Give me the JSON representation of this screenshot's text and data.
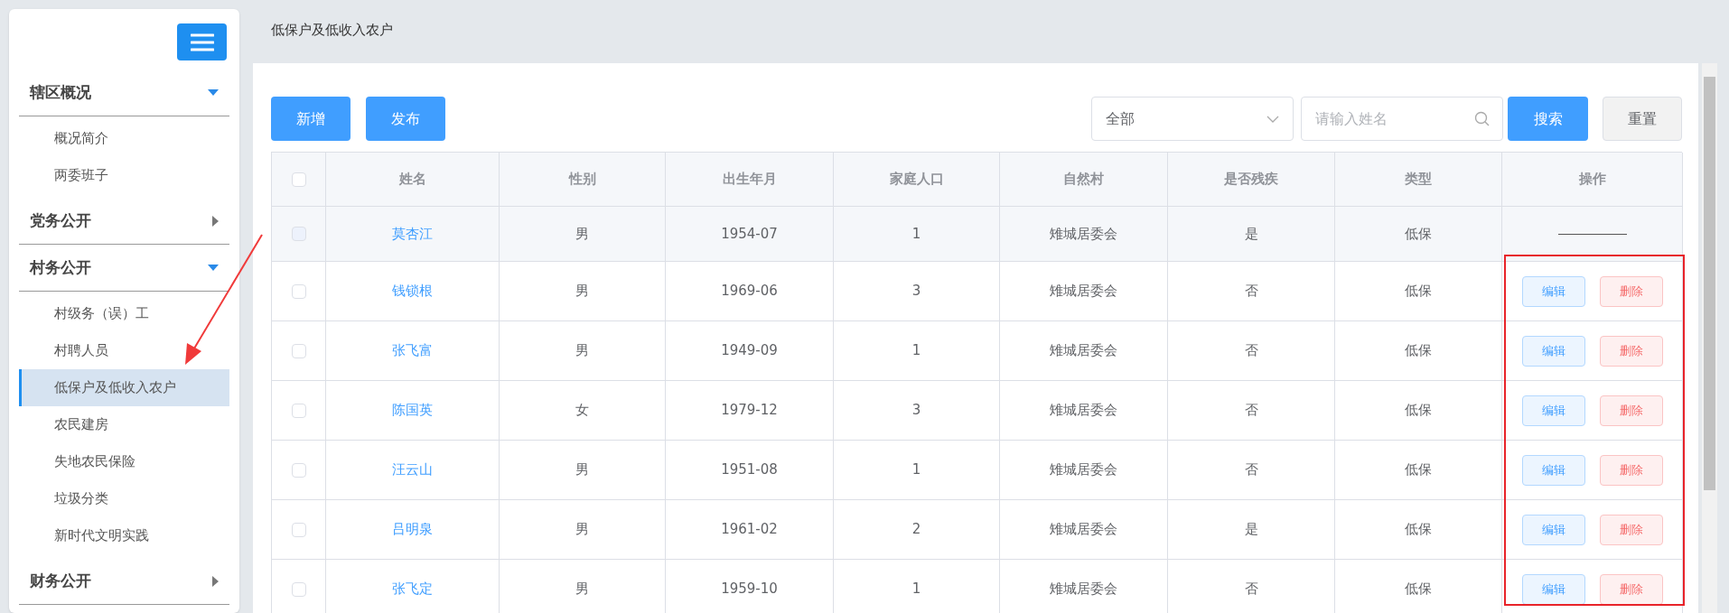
{
  "sidebar": {
    "sections": [
      {
        "title": "辖区概况",
        "expanded": true,
        "items": [
          {
            "label": "概况简介",
            "selected": false
          },
          {
            "label": "两委班子",
            "selected": false
          }
        ]
      },
      {
        "title": "党务公开",
        "expanded": false
      },
      {
        "title": "村务公开",
        "expanded": true,
        "items": [
          {
            "label": "村级务（误）工",
            "selected": false
          },
          {
            "label": "村聘人员",
            "selected": false
          },
          {
            "label": "低保户及低收入农户",
            "selected": true
          },
          {
            "label": "农民建房",
            "selected": false
          },
          {
            "label": "失地农民保险",
            "selected": false
          },
          {
            "label": "垃圾分类",
            "selected": false
          },
          {
            "label": "新时代文明实践",
            "selected": false
          }
        ]
      },
      {
        "title": "财务公开",
        "expanded": false
      }
    ]
  },
  "page_title": "低保户及低收入农户",
  "toolbar": {
    "buttons": [
      "新增",
      "发布"
    ],
    "filter": {
      "value": "全部"
    },
    "search": {
      "placeholder": "请输入姓名"
    },
    "search_button": "搜索",
    "reset_button": "重置"
  },
  "table": {
    "select_all": {
      "checked": false
    },
    "columns": [
      "姓名",
      "性别",
      "出生年月",
      "家庭人口",
      "自然村",
      "是否残疾",
      "类型",
      "操作"
    ],
    "rows": [
      {
        "cells": [
          "莫杏江",
          "男",
          "1954-07",
          "1",
          "雉城居委会",
          "是",
          "低保"
        ],
        "disabled": true,
        "actions": []
      },
      {
        "cells": [
          "钱锁根",
          "男",
          "1969-06",
          "3",
          "雉城居委会",
          "否",
          "低保"
        ],
        "disabled": false,
        "actions": [
          "编辑",
          "删除"
        ]
      },
      {
        "cells": [
          "张飞富",
          "男",
          "1949-09",
          "1",
          "雉城居委会",
          "否",
          "低保"
        ],
        "disabled": false,
        "actions": [
          "编辑",
          "删除"
        ]
      },
      {
        "cells": [
          "陈国英",
          "女",
          "1979-12",
          "3",
          "雉城居委会",
          "否",
          "低保"
        ],
        "disabled": false,
        "actions": [
          "编辑",
          "删除"
        ]
      },
      {
        "cells": [
          "汪云山",
          "男",
          "1951-08",
          "1",
          "雉城居委会",
          "否",
          "低保"
        ],
        "disabled": false,
        "actions": [
          "编辑",
          "删除"
        ]
      },
      {
        "cells": [
          "吕明泉",
          "男",
          "1961-02",
          "2",
          "雉城居委会",
          "是",
          "低保"
        ],
        "disabled": false,
        "actions": [
          "编辑",
          "删除"
        ]
      },
      {
        "cells": [
          "张飞定",
          "男",
          "1959-10",
          "1",
          "雉城居委会",
          "否",
          "低保"
        ],
        "disabled": false,
        "actions": [
          "编辑",
          "删除"
        ]
      }
    ]
  }
}
